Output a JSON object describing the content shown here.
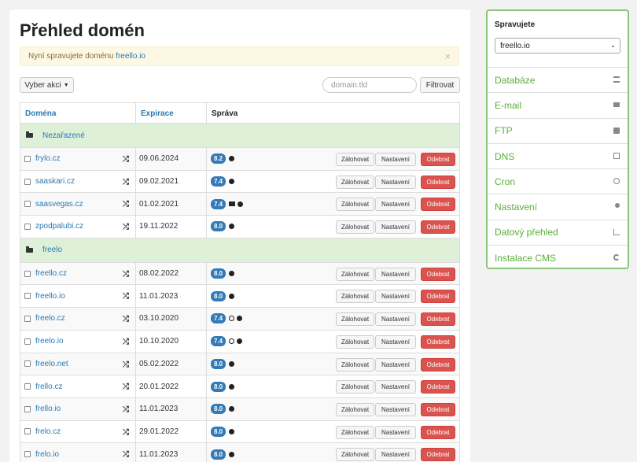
{
  "page": {
    "title": "Přehled domén",
    "alert_text": "Nyní spravujete doménu",
    "alert_domain": "freello.io",
    "alert_close": "×"
  },
  "toolbar": {
    "actions_label": "Vyber akci",
    "filter_placeholder": "domain.tld",
    "filter_button": "Filtrovat"
  },
  "table": {
    "headers": {
      "domain": "Doména",
      "expiration": "Expirace",
      "manage": "Správa"
    },
    "buttons": {
      "backup": "Zálohovat",
      "settings": "Nastavení",
      "remove": "Odebrat"
    },
    "groups": [
      {
        "name": "Nezařazené",
        "rows": [
          {
            "domain": "frylo.cz",
            "expiration": "09.06.2024",
            "php": "8.2",
            "icons": [
              "globe"
            ]
          },
          {
            "domain": "saaskari.cz",
            "expiration": "09.02.2021",
            "php": "7.4",
            "icons": [
              "globe"
            ]
          },
          {
            "domain": "saasvegas.cz",
            "expiration": "01.02.2021",
            "php": "7.4",
            "icons": [
              "mail",
              "globe"
            ]
          },
          {
            "domain": "zpodpalubi.cz",
            "expiration": "19.11.2022",
            "php": "8.0",
            "icons": [
              "globe"
            ]
          }
        ]
      },
      {
        "name": "freelo",
        "rows": [
          {
            "domain": "freello.cz",
            "expiration": "08.02.2022",
            "php": "8.0",
            "icons": [
              "globe"
            ]
          },
          {
            "domain": "freello.io",
            "expiration": "11.01.2023",
            "php": "8.0",
            "icons": [
              "globe"
            ]
          },
          {
            "domain": "freelo.cz",
            "expiration": "03.10.2020",
            "php": "7.4",
            "icons": [
              "clock",
              "globe"
            ]
          },
          {
            "domain": "freelo.io",
            "expiration": "10.10.2020",
            "php": "7.4",
            "icons": [
              "clock",
              "globe"
            ]
          },
          {
            "domain": "freelo.net",
            "expiration": "05.02.2022",
            "php": "8.0",
            "icons": [
              "globe"
            ]
          },
          {
            "domain": "frello.cz",
            "expiration": "20.01.2022",
            "php": "8.0",
            "icons": [
              "globe"
            ]
          },
          {
            "domain": "frello.io",
            "expiration": "11.01.2023",
            "php": "8.0",
            "icons": [
              "globe"
            ]
          },
          {
            "domain": "frelo.cz",
            "expiration": "29.01.2022",
            "php": "8.0",
            "icons": [
              "globe"
            ]
          },
          {
            "domain": "frelo.io",
            "expiration": "11.01.2023",
            "php": "8.0",
            "icons": [
              "globe"
            ]
          }
        ]
      }
    ]
  },
  "sidebar": {
    "title": "Spravujete",
    "selected_domain": "freello.io",
    "items": [
      {
        "label": "Databáze",
        "icon": "database-icon"
      },
      {
        "label": "E-mail",
        "icon": "mail-icon"
      },
      {
        "label": "FTP",
        "icon": "ftp-icon"
      },
      {
        "label": "DNS",
        "icon": "dns-icon"
      },
      {
        "label": "Cron",
        "icon": "clock-icon"
      },
      {
        "label": "Nastavení",
        "icon": "gear-icon"
      },
      {
        "label": "Datový přehled",
        "icon": "chart-icon"
      },
      {
        "label": "Instalace CMS",
        "icon": "refresh-icon"
      }
    ]
  },
  "colors": {
    "link": "#2a7ab0",
    "sidebar_accent": "#5cad3c",
    "group_bg": "#dff0d8",
    "remove_button": "#d9534f",
    "php_badge": "#337ab7"
  }
}
